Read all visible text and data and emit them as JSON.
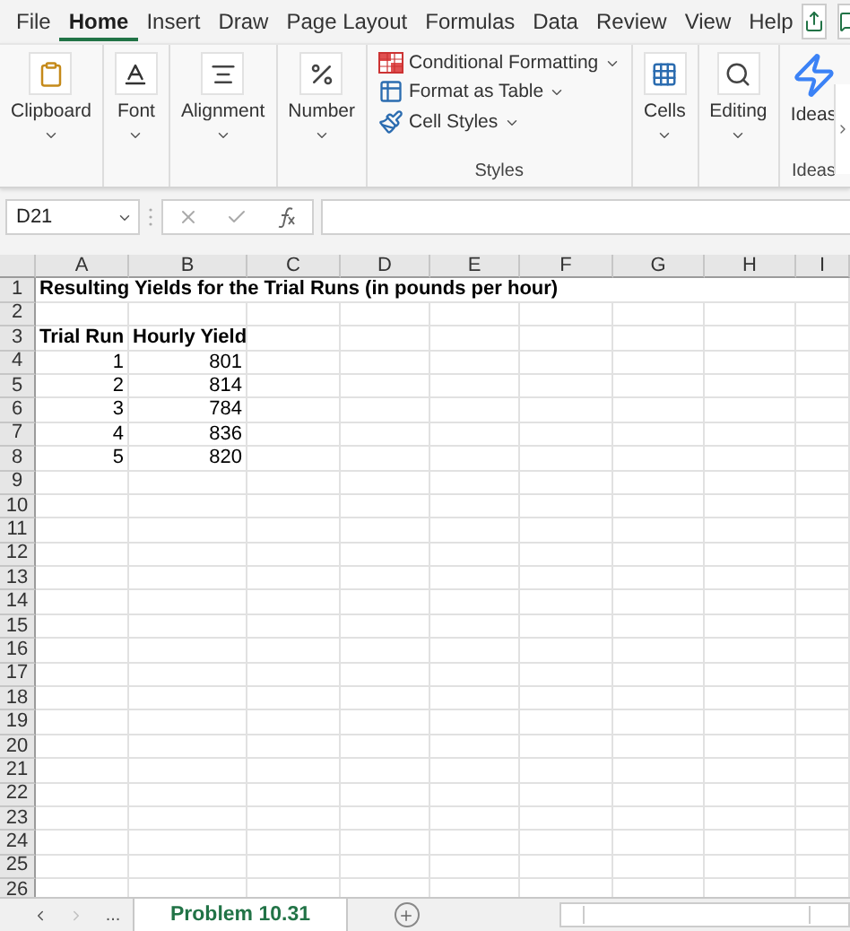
{
  "menu_tabs": [
    {
      "label": "File",
      "selected": false
    },
    {
      "label": "Home",
      "selected": true
    },
    {
      "label": "Insert",
      "selected": false
    },
    {
      "label": "Draw",
      "selected": false
    },
    {
      "label": "Page Layout",
      "selected": false
    },
    {
      "label": "Formulas",
      "selected": false
    },
    {
      "label": "Data",
      "selected": false
    },
    {
      "label": "Review",
      "selected": false
    },
    {
      "label": "View",
      "selected": false
    },
    {
      "label": "Help",
      "selected": false
    }
  ],
  "ribbon": {
    "groups": [
      {
        "kind": "big",
        "label": "Clipboard"
      },
      {
        "kind": "big",
        "label": "Font"
      },
      {
        "kind": "big",
        "label": "Alignment"
      },
      {
        "kind": "big",
        "label": "Number"
      },
      {
        "kind": "styles",
        "label": "Styles",
        "items": [
          {
            "label": "Conditional Formatting"
          },
          {
            "label": "Format as Table"
          },
          {
            "label": "Cell Styles"
          }
        ]
      },
      {
        "kind": "big",
        "label": "Cells"
      },
      {
        "kind": "big",
        "label": "Editing"
      },
      {
        "kind": "ideas",
        "label": "Ideas",
        "group_label": "Ideas"
      }
    ]
  },
  "name_box": "D21",
  "columns": [
    "A",
    "B",
    "C",
    "D",
    "E",
    "F",
    "G",
    "H",
    "I"
  ],
  "rows": [
    {
      "header": "1",
      "cells": [
        {
          "kind": "title",
          "text": "Resulting Yields for the Trial Runs (in pounds per hour)"
        }
      ]
    },
    {
      "header": "2",
      "cells": []
    },
    {
      "header": "3",
      "cells": [
        {
          "kind": "label",
          "text": "Trial Run"
        },
        {
          "kind": "label",
          "text": "Hourly Yield"
        }
      ]
    },
    {
      "header": "4",
      "cells": [
        {
          "kind": "number",
          "text": "1"
        },
        {
          "kind": "number",
          "text": "801"
        }
      ]
    },
    {
      "header": "5",
      "cells": [
        {
          "kind": "number",
          "text": "2"
        },
        {
          "kind": "number",
          "text": "814"
        }
      ]
    },
    {
      "header": "6",
      "cells": [
        {
          "kind": "number",
          "text": "3"
        },
        {
          "kind": "number",
          "text": "784"
        }
      ]
    },
    {
      "header": "7",
      "cells": [
        {
          "kind": "number",
          "text": "4"
        },
        {
          "kind": "number",
          "text": "836"
        }
      ]
    },
    {
      "header": "8",
      "cells": [
        {
          "kind": "number",
          "text": "5"
        },
        {
          "kind": "number",
          "text": "820"
        }
      ]
    },
    {
      "header": "9",
      "cells": []
    },
    {
      "header": "10",
      "cells": []
    },
    {
      "header": "11",
      "cells": []
    },
    {
      "header": "12",
      "cells": []
    },
    {
      "header": "13",
      "cells": []
    },
    {
      "header": "14",
      "cells": []
    },
    {
      "header": "15",
      "cells": []
    },
    {
      "header": "16",
      "cells": []
    },
    {
      "header": "17",
      "cells": []
    },
    {
      "header": "18",
      "cells": []
    },
    {
      "header": "19",
      "cells": []
    },
    {
      "header": "20",
      "cells": []
    },
    {
      "header": "21",
      "cells": []
    },
    {
      "header": "22",
      "cells": []
    },
    {
      "header": "23",
      "cells": []
    },
    {
      "header": "24",
      "cells": []
    },
    {
      "header": "25",
      "cells": []
    },
    {
      "header": "26",
      "cells": []
    }
  ],
  "sheet_nav": {
    "more": "..."
  },
  "sheet_tabs": [
    {
      "label": "Problem 10.31",
      "selected": true
    }
  ]
}
